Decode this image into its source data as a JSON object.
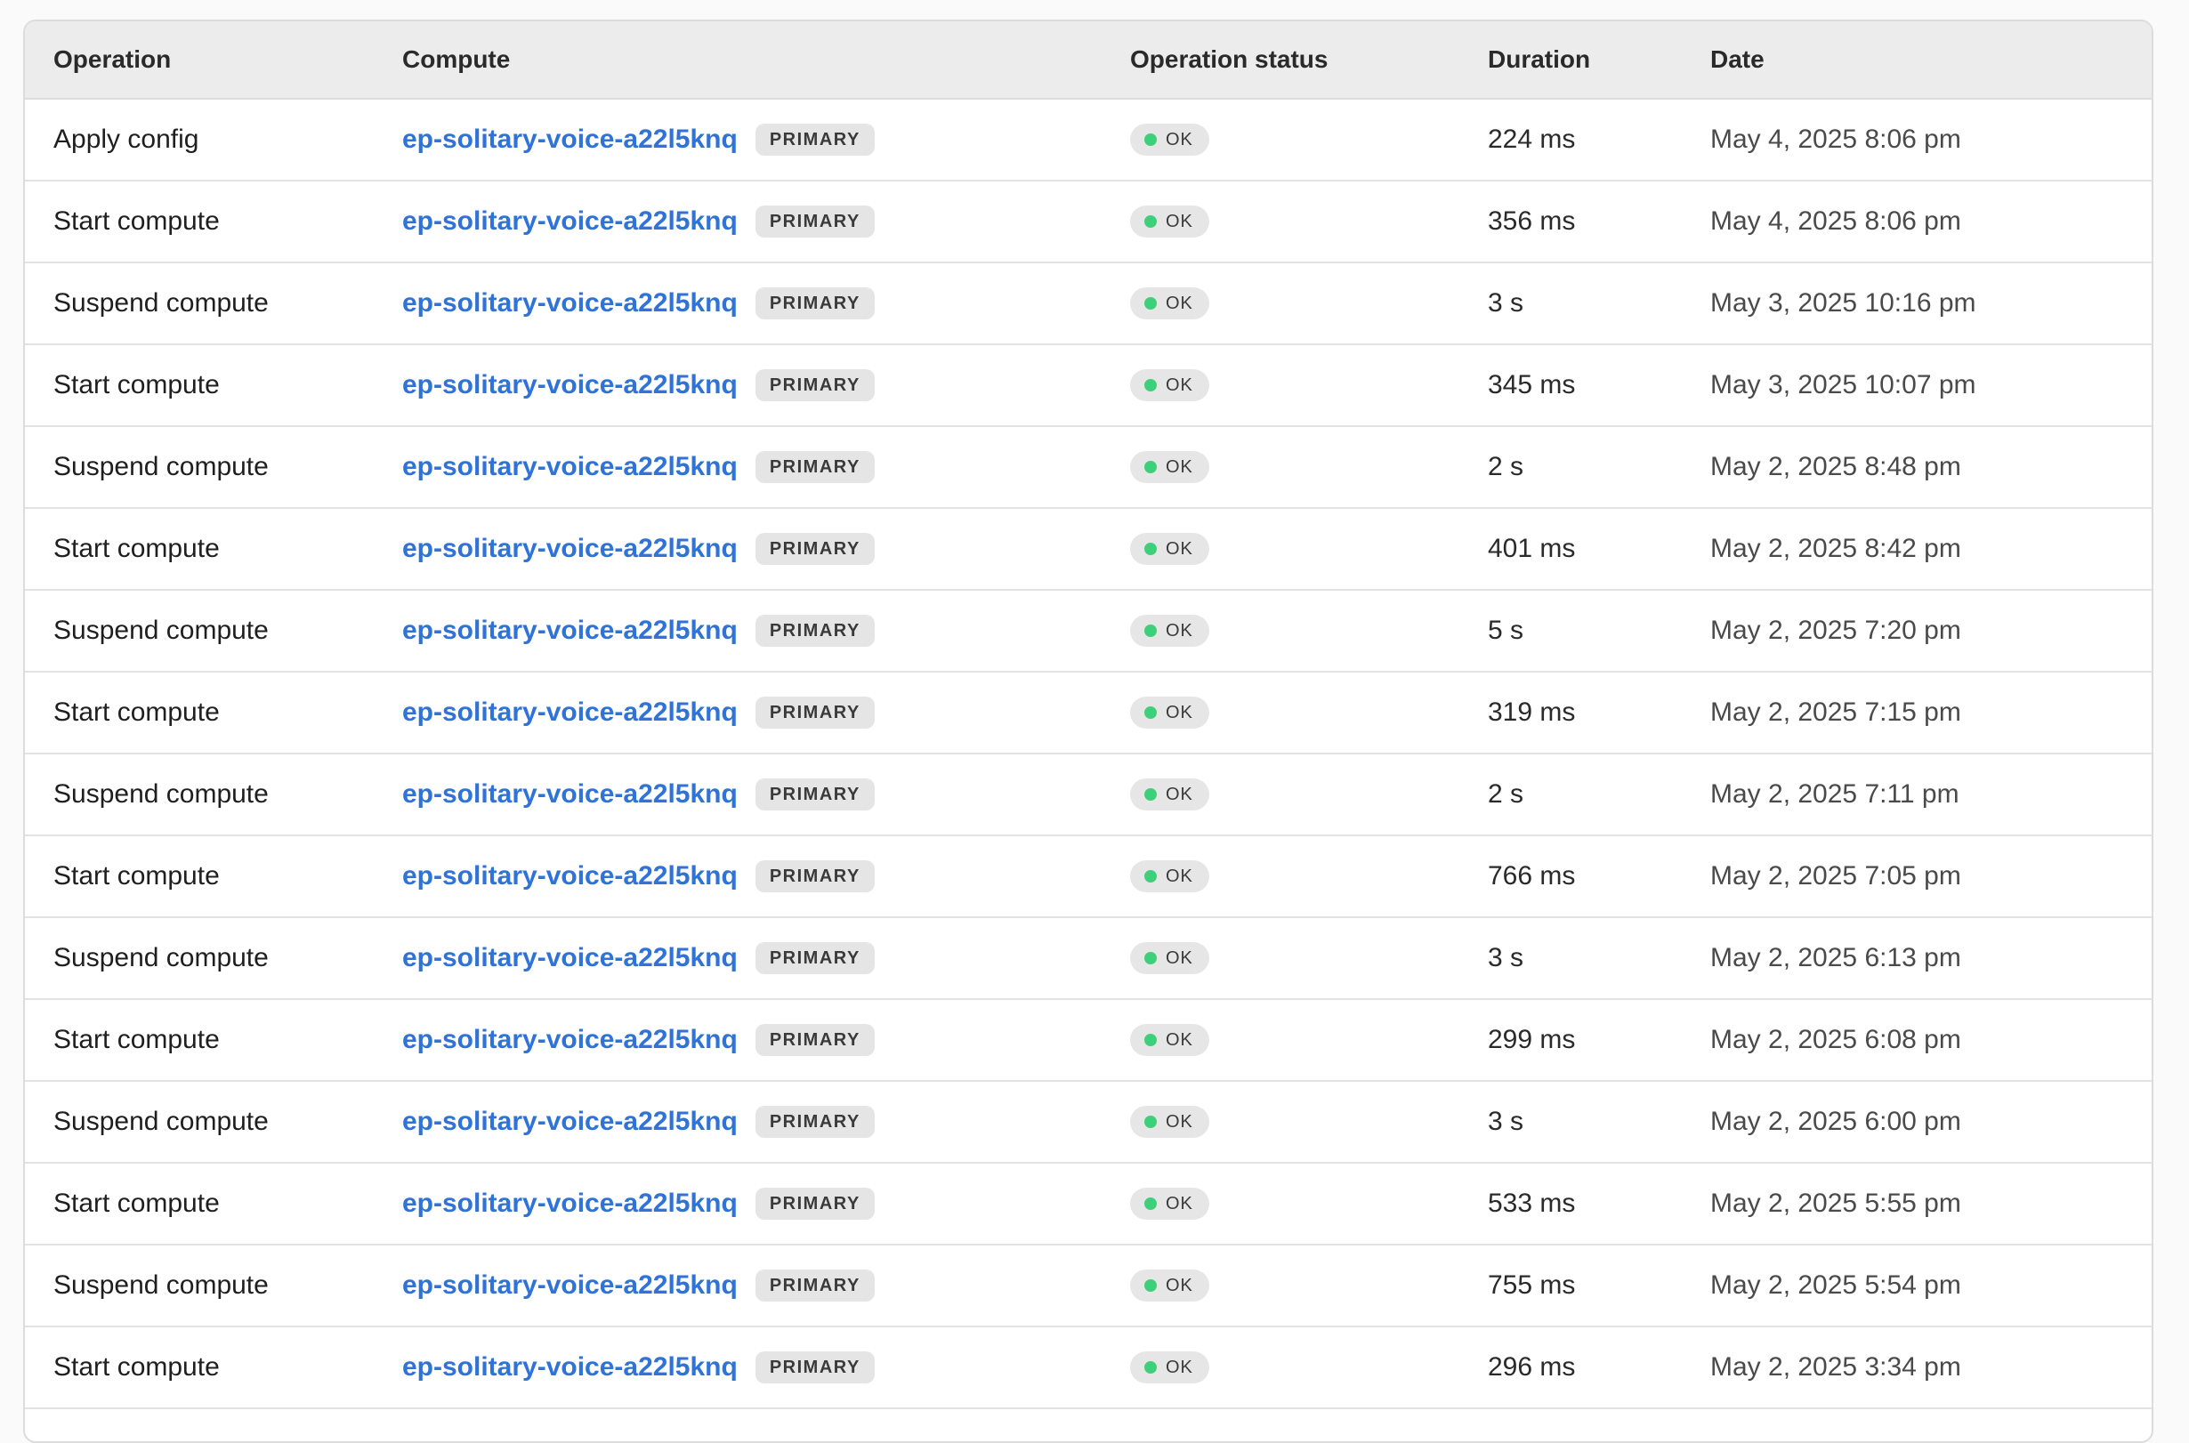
{
  "table": {
    "headers": {
      "operation": "Operation",
      "compute": "Compute",
      "status": "Operation status",
      "duration": "Duration",
      "date": "Date"
    },
    "status_color": "#3ecf7a",
    "link_color": "#2f72d8",
    "rows": [
      {
        "operation": "Apply config",
        "compute": "ep-solitary-voice-a22l5knq",
        "badge": "PRIMARY",
        "status": "OK",
        "duration": "224 ms",
        "date": "May 4, 2025 8:06 pm"
      },
      {
        "operation": "Start compute",
        "compute": "ep-solitary-voice-a22l5knq",
        "badge": "PRIMARY",
        "status": "OK",
        "duration": "356 ms",
        "date": "May 4, 2025 8:06 pm"
      },
      {
        "operation": "Suspend compute",
        "compute": "ep-solitary-voice-a22l5knq",
        "badge": "PRIMARY",
        "status": "OK",
        "duration": "3 s",
        "date": "May 3, 2025 10:16 pm"
      },
      {
        "operation": "Start compute",
        "compute": "ep-solitary-voice-a22l5knq",
        "badge": "PRIMARY",
        "status": "OK",
        "duration": "345 ms",
        "date": "May 3, 2025 10:07 pm"
      },
      {
        "operation": "Suspend compute",
        "compute": "ep-solitary-voice-a22l5knq",
        "badge": "PRIMARY",
        "status": "OK",
        "duration": "2 s",
        "date": "May 2, 2025 8:48 pm"
      },
      {
        "operation": "Start compute",
        "compute": "ep-solitary-voice-a22l5knq",
        "badge": "PRIMARY",
        "status": "OK",
        "duration": "401 ms",
        "date": "May 2, 2025 8:42 pm"
      },
      {
        "operation": "Suspend compute",
        "compute": "ep-solitary-voice-a22l5knq",
        "badge": "PRIMARY",
        "status": "OK",
        "duration": "5 s",
        "date": "May 2, 2025 7:20 pm"
      },
      {
        "operation": "Start compute",
        "compute": "ep-solitary-voice-a22l5knq",
        "badge": "PRIMARY",
        "status": "OK",
        "duration": "319 ms",
        "date": "May 2, 2025 7:15 pm"
      },
      {
        "operation": "Suspend compute",
        "compute": "ep-solitary-voice-a22l5knq",
        "badge": "PRIMARY",
        "status": "OK",
        "duration": "2 s",
        "date": "May 2, 2025 7:11 pm"
      },
      {
        "operation": "Start compute",
        "compute": "ep-solitary-voice-a22l5knq",
        "badge": "PRIMARY",
        "status": "OK",
        "duration": "766 ms",
        "date": "May 2, 2025 7:05 pm"
      },
      {
        "operation": "Suspend compute",
        "compute": "ep-solitary-voice-a22l5knq",
        "badge": "PRIMARY",
        "status": "OK",
        "duration": "3 s",
        "date": "May 2, 2025 6:13 pm"
      },
      {
        "operation": "Start compute",
        "compute": "ep-solitary-voice-a22l5knq",
        "badge": "PRIMARY",
        "status": "OK",
        "duration": "299 ms",
        "date": "May 2, 2025 6:08 pm"
      },
      {
        "operation": "Suspend compute",
        "compute": "ep-solitary-voice-a22l5knq",
        "badge": "PRIMARY",
        "status": "OK",
        "duration": "3 s",
        "date": "May 2, 2025 6:00 pm"
      },
      {
        "operation": "Start compute",
        "compute": "ep-solitary-voice-a22l5knq",
        "badge": "PRIMARY",
        "status": "OK",
        "duration": "533 ms",
        "date": "May 2, 2025 5:55 pm"
      },
      {
        "operation": "Suspend compute",
        "compute": "ep-solitary-voice-a22l5knq",
        "badge": "PRIMARY",
        "status": "OK",
        "duration": "755 ms",
        "date": "May 2, 2025 5:54 pm"
      },
      {
        "operation": "Start compute",
        "compute": "ep-solitary-voice-a22l5knq",
        "badge": "PRIMARY",
        "status": "OK",
        "duration": "296 ms",
        "date": "May 2, 2025 3:34 pm"
      }
    ]
  }
}
